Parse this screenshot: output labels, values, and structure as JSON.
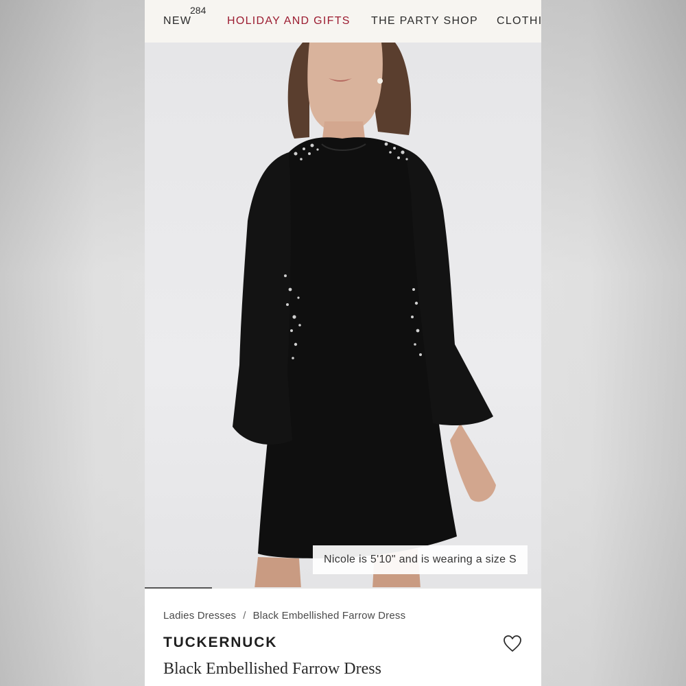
{
  "nav": {
    "items": [
      {
        "label": "NEW",
        "badge": "284"
      },
      {
        "label": "HOLIDAY AND GIFTS"
      },
      {
        "label": "THE PARTY SHOP"
      },
      {
        "label": "CLOTHI"
      }
    ]
  },
  "hero": {
    "caption": "Nicole is 5'10\" and is wearing a size S",
    "gallery_progress": 0.17
  },
  "product": {
    "breadcrumb": [
      "Ladies Dresses",
      "Black Embellished Farrow Dress"
    ],
    "breadcrumb_separator": "/",
    "brand": "TUCKERNUCK",
    "title": "Black Embellished Farrow Dress"
  },
  "icons": {
    "wishlist": "heart-icon"
  },
  "colors": {
    "nav_active": "#9b1b30",
    "nav_bg": "#f7f5f1"
  }
}
